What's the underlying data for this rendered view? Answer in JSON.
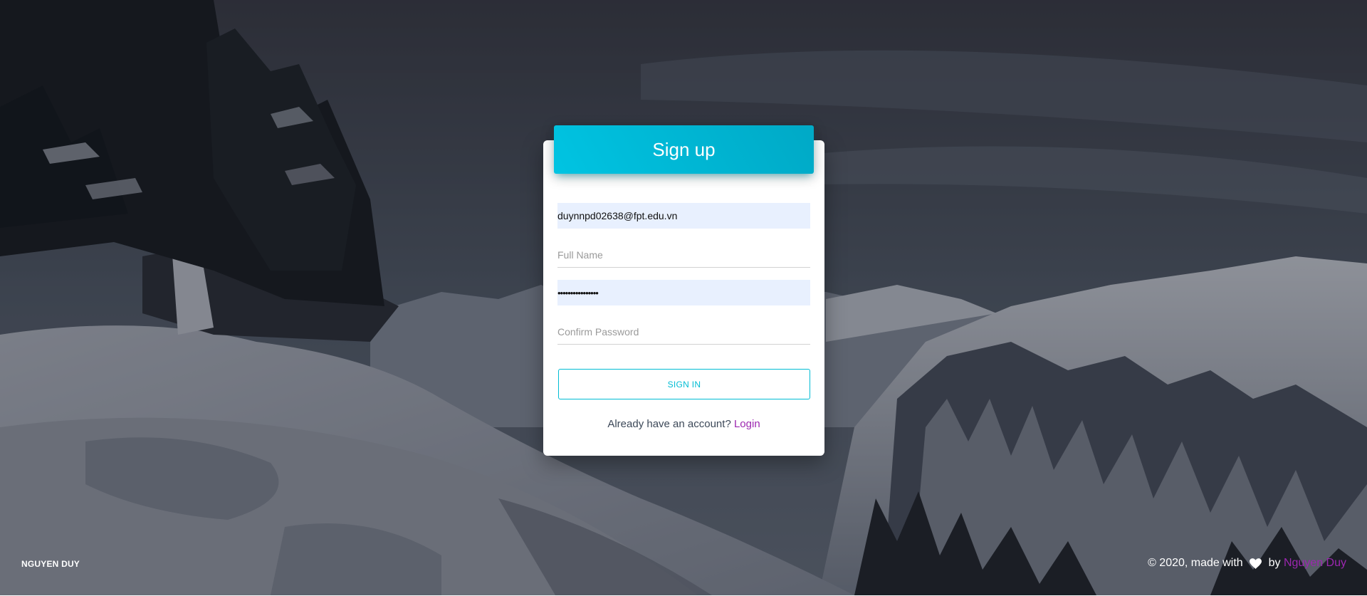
{
  "card": {
    "title": "Sign up",
    "email_value": "duynnpd02638@fpt.edu.vn",
    "fullname_placeholder": "Full Name",
    "password_value": "••••••••••••••••",
    "confirm_placeholder": "Confirm Password",
    "signin_label": "SIGN IN",
    "already_text": "Already have an account? ",
    "login_link": "Login"
  },
  "footer": {
    "brand": "NGUYEN DUY",
    "copyright_prefix": "© 2020, made with ",
    "copyright_by": " by ",
    "author": "Nguyen Duy"
  },
  "colors": {
    "accent": "#00bcd4",
    "link": "#9c27b0",
    "autofill": "#e8f0fe"
  },
  "icons": {
    "heart": "heart-icon"
  }
}
